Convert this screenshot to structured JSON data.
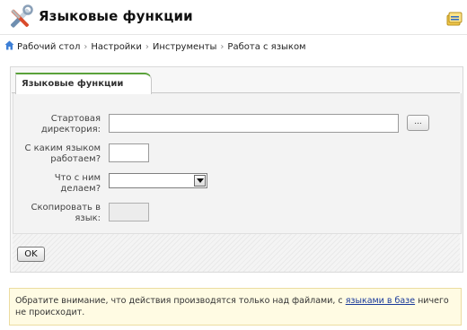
{
  "header": {
    "title": "Языковые функции",
    "tools_icon": "wrench-screwdriver-icon",
    "help_icon": "help-icon"
  },
  "breadcrumb": {
    "home_icon": "home-icon",
    "items": [
      "Рабочий стол",
      "Настройки",
      "Инструменты",
      "Работа с языком"
    ],
    "separator": "›"
  },
  "tab": {
    "label": "Языковые функции",
    "accent": "#5aa23a"
  },
  "form": {
    "start_dir_label_1": "Стартовая",
    "start_dir_label_2": "директория:",
    "start_dir_value": "",
    "browse_label": "...",
    "lang_label_1": "С каким языком",
    "lang_label_2": "работаем?",
    "lang_value": "",
    "action_label_1": "Что с ним",
    "action_label_2": "делаем?",
    "action_selected": "",
    "copy_label_1": "Скопировать в",
    "copy_label_2": "язык:",
    "copy_value": ""
  },
  "actions": {
    "ok_label": "OK"
  },
  "notice": {
    "text_before": "Обратите внимание, что действия производятся только над файлами, с ",
    "link_text": "языками в базе",
    "text_after": " ничего не происходит.",
    "bg": "#fffbe3"
  }
}
